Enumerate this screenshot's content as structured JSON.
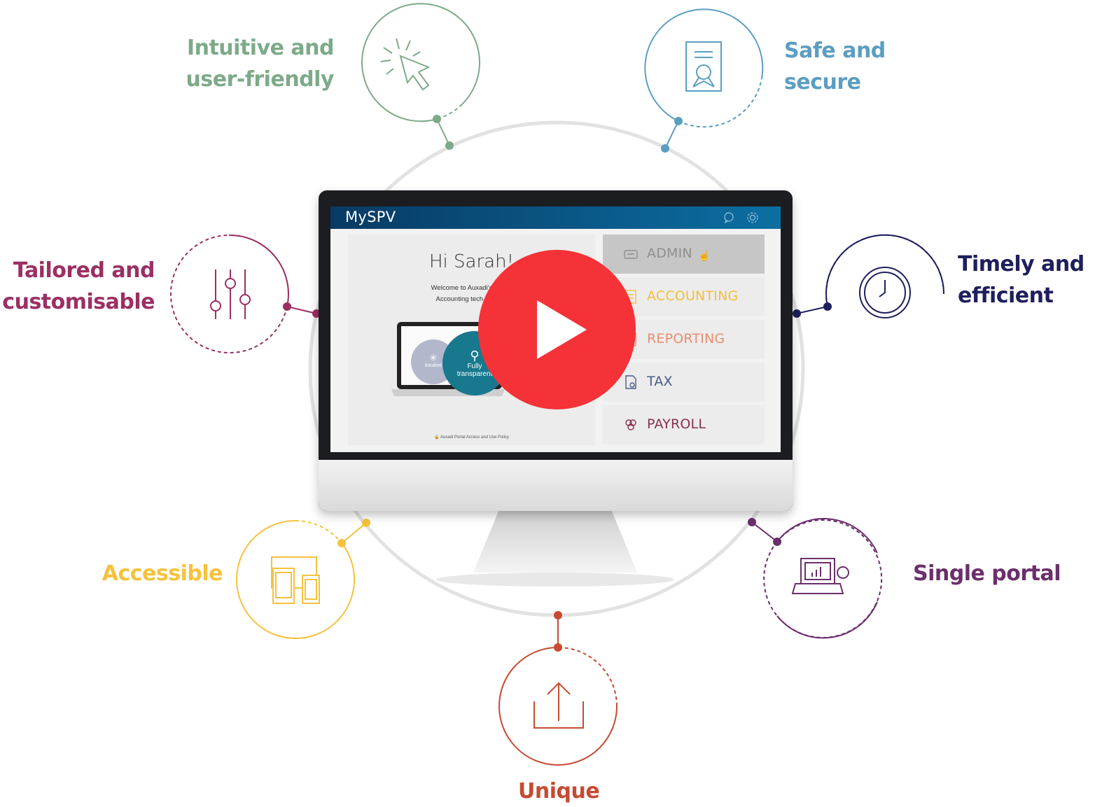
{
  "features": {
    "intuitive": {
      "lines": [
        "Intuitive and",
        "user-friendly"
      ],
      "color": "#7daa8a",
      "icon": "cursor-click-icon"
    },
    "safe": {
      "lines": [
        "Safe and",
        "secure"
      ],
      "color": "#5b9ec1",
      "icon": "certificate-icon"
    },
    "tailored": {
      "lines": [
        "Tailored and",
        "customisable"
      ],
      "color": "#9b2f63",
      "icon": "sliders-icon"
    },
    "timely": {
      "lines": [
        "Timely and",
        "efficient"
      ],
      "color": "#1e1f5c",
      "icon": "clock-icon"
    },
    "accessible": {
      "lines": [
        "Accessible"
      ],
      "color": "#f6c23d",
      "icon": "devices-icon"
    },
    "single": {
      "lines": [
        "Single portal"
      ],
      "color": "#6b2f6b",
      "icon": "laptop-gear-icon"
    },
    "unique": {
      "lines": [
        "Unique"
      ],
      "color": "#c64b32",
      "icon": "upload-icon"
    }
  },
  "app": {
    "logo": "MySPV",
    "greeting": "Hi Sarah!",
    "welcome_line_1": "Welcome to Auxadi's Multio",
    "welcome_line_2": "Accounting tech for mult",
    "bubble_intuitive": "Intuitive",
    "bubble_transparent_1": "Fully",
    "bubble_transparent_2": "transparent",
    "policy": "🔒 Auxadi Portal Access and Use Policy",
    "menu": [
      {
        "label": "ADMIN",
        "color": "#8f8f8f",
        "icon": "admin-icon",
        "active": true
      },
      {
        "label": "ACCOUNTING",
        "color": "#f4be3e",
        "icon": "accounting-icon",
        "active": false
      },
      {
        "label": "REPORTING",
        "color": "#e98e6f",
        "icon": "reporting-icon",
        "active": false
      },
      {
        "label": "TAX",
        "color": "#4a5a8a",
        "icon": "tax-icon",
        "active": false
      },
      {
        "label": "PAYROLL",
        "color": "#8a2f4f",
        "icon": "payroll-icon",
        "active": false
      }
    ]
  },
  "colors": {
    "play": "#f53237",
    "ring": "#e2e2e2",
    "header_start": "#083a64",
    "header_end": "#0b6fa2"
  }
}
